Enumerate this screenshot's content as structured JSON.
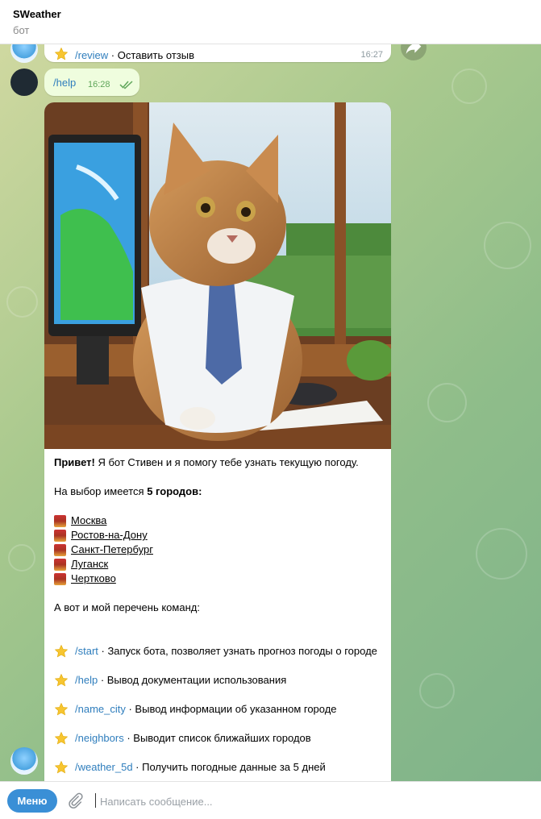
{
  "header": {
    "title": "SWeather",
    "subtitle": "бот"
  },
  "messages": {
    "prev": {
      "command": "/review",
      "desc": " · Оставить отзыв",
      "time": "16:27"
    },
    "user": {
      "text": "/help",
      "time": "16:28"
    },
    "help": {
      "greeting_bold": "Привет!",
      "greeting_rest": " Я бот Стивен и я помогу тебе узнать текущую погоду.",
      "choice_prefix": "На выбор имеется ",
      "choice_bold": "5 городов:",
      "cities": [
        "Москва",
        "Ростов-на-Дону",
        "Санкт-Петербург",
        "Луганск",
        "Чертково"
      ],
      "commands_intro": "А вот и мой перечень команд:",
      "commands": [
        {
          "cmd": "/start",
          "desc": " · Запуск бота, позволяет узнать прогноз погоды о городе"
        },
        {
          "cmd": "/help",
          "desc": " · Вывод документации использования"
        },
        {
          "cmd": "/name_city",
          "desc": " · Вывод информации об указанном городе"
        },
        {
          "cmd": "/neighbors",
          "desc": " · Выводит список ближайших городов"
        },
        {
          "cmd": "/weather_5d",
          "desc": " · Получить погодные данные за 5 дней"
        }
      ]
    }
  },
  "input": {
    "menu_label": "Меню",
    "placeholder": "Написать сообщение..."
  },
  "colors": {
    "link": "#2f7ebd",
    "menu": "#3a8fd6",
    "outgoing_bubble": "#effdde"
  },
  "icons": {
    "star": "star-icon",
    "building": "city-building-icon",
    "attach": "paperclip-icon",
    "forward": "forward-icon",
    "read": "double-check-icon"
  }
}
